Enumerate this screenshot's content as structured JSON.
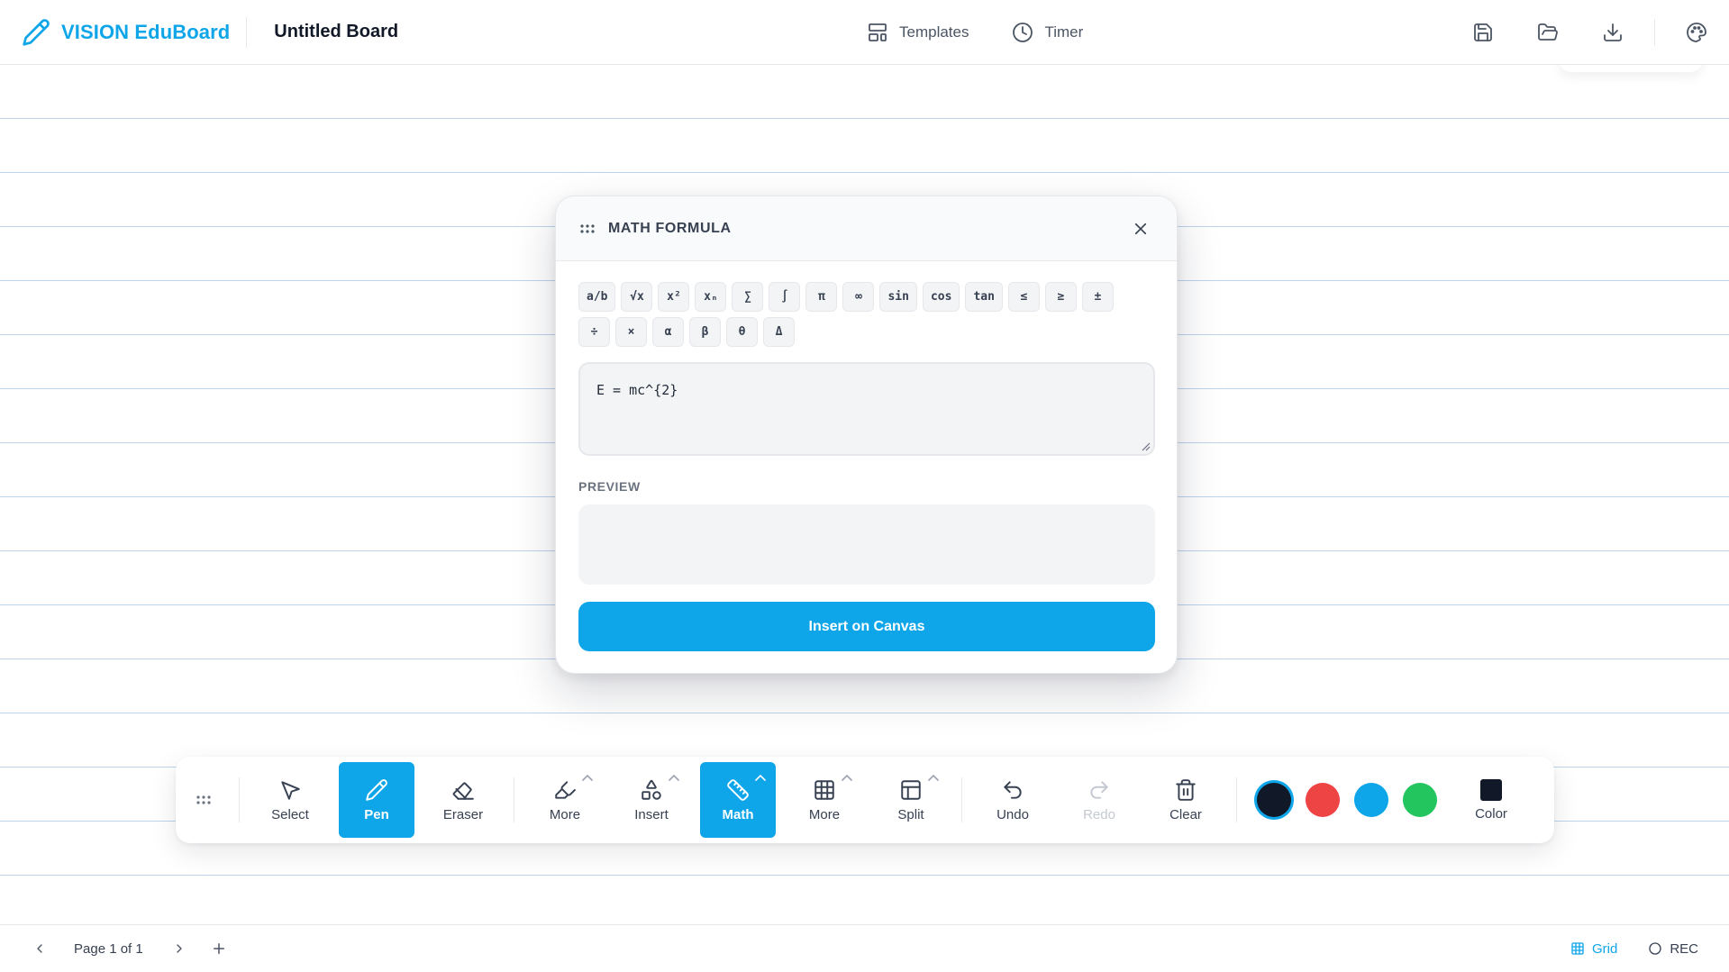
{
  "header": {
    "brand": "VISION EduBoard",
    "board_title": "Untitled Board",
    "nav": [
      {
        "label": "Templates",
        "icon": "layout-template-icon"
      },
      {
        "label": "Timer",
        "icon": "clock-icon"
      }
    ],
    "actions": [
      "save-icon",
      "folder-open-icon",
      "download-icon",
      "palette-icon"
    ]
  },
  "math_modal": {
    "title": "MATH FORMULA",
    "symbols": [
      "a/b",
      "√x",
      "x²",
      "xₙ",
      "∑",
      "∫",
      "π",
      "∞",
      "sin",
      "cos",
      "tan",
      "≤",
      "≥",
      "±",
      "÷",
      "×",
      "α",
      "β",
      "θ",
      "Δ"
    ],
    "formula_value": "E = mc^{2}",
    "preview_label": "PREVIEW",
    "insert_label": "Insert on Canvas"
  },
  "toolbar": {
    "tools": [
      {
        "label": "Select",
        "icon": "pointer-icon",
        "state": "normal"
      },
      {
        "label": "Pen",
        "icon": "pen-icon",
        "state": "active"
      },
      {
        "label": "Eraser",
        "icon": "eraser-icon",
        "state": "normal"
      },
      {
        "label": "More",
        "icon": "highlighter-icon",
        "state": "normal"
      },
      {
        "label": "Insert",
        "icon": "shapes-icon",
        "state": "normal"
      },
      {
        "label": "Math",
        "icon": "ruler-icon",
        "state": "active"
      },
      {
        "label": "More",
        "icon": "grid-icon",
        "state": "normal"
      },
      {
        "label": "Split",
        "icon": "layout-split-icon",
        "state": "normal"
      },
      {
        "label": "Undo",
        "icon": "undo-icon",
        "state": "normal"
      },
      {
        "label": "Redo",
        "icon": "redo-icon",
        "state": "disabled"
      },
      {
        "label": "Clear",
        "icon": "trash-icon",
        "state": "normal"
      }
    ],
    "swatches": [
      "#111827",
      "#ef4444",
      "#0ea5e9",
      "#22c55e"
    ],
    "selected_swatch": "#111827",
    "color_label": "Color"
  },
  "footer": {
    "page_label": "Page 1 of 1",
    "grid_label": "Grid",
    "rec_label": "REC"
  },
  "colors": {
    "accent": "#0ea5e9",
    "line": "#bcd3ea"
  }
}
